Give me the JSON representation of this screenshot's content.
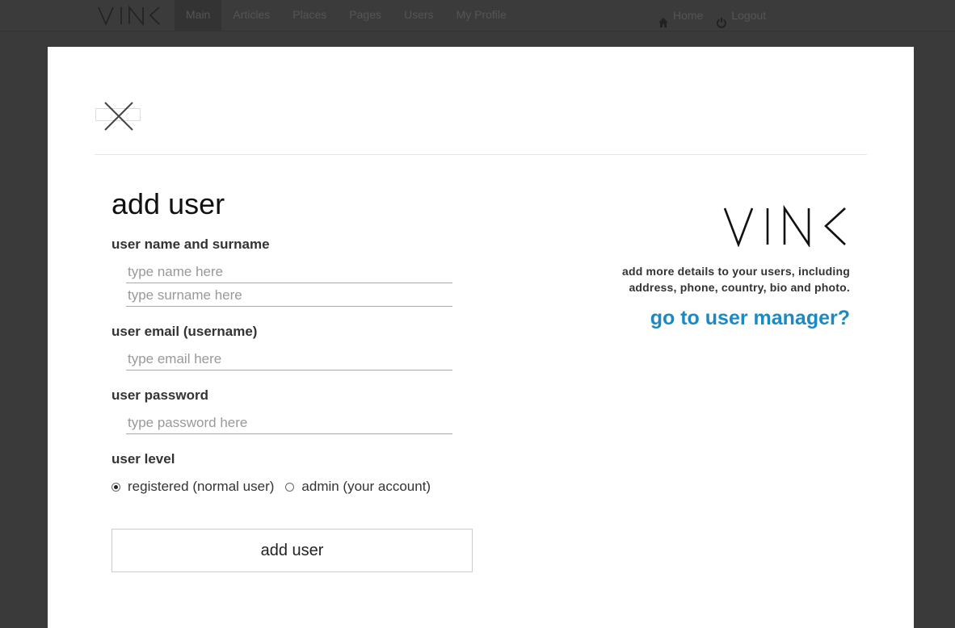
{
  "navbar": {
    "brand": "VINK",
    "items": [
      {
        "label": "Main",
        "active": true
      },
      {
        "label": "Articles",
        "active": false
      },
      {
        "label": "Places",
        "active": false
      },
      {
        "label": "Pages",
        "active": false
      },
      {
        "label": "Users",
        "active": false
      },
      {
        "label": "My Profile",
        "active": false
      }
    ],
    "home_label": "Home",
    "logout_label": "Logout",
    "home_icon": "home-icon",
    "logout_icon": "power-icon"
  },
  "modal": {
    "close_icon": "close-icon",
    "title": "add user",
    "name_label": "user name and surname",
    "name_placeholder": "type name here",
    "surname_placeholder": "type surname here",
    "email_label": "user email (username)",
    "email_placeholder": "type email here",
    "password_label": "user password",
    "password_placeholder": "type password here",
    "level_label": "user level",
    "level_options": [
      {
        "label": "registered (normal user)",
        "checked": true
      },
      {
        "label": "admin (your account)",
        "checked": false
      }
    ],
    "submit_label": "add user",
    "side": {
      "brand": "VINK",
      "text_line1": "add more details to your users, including",
      "text_line2": "address, phone, country, bio and photo.",
      "link_label": "go to user manager?",
      "link_color": "#1a8ac6"
    }
  },
  "colors": {
    "backdrop": "#3a3a3a",
    "modal_bg": "#ffffff",
    "accent": "#1a8ac6"
  }
}
